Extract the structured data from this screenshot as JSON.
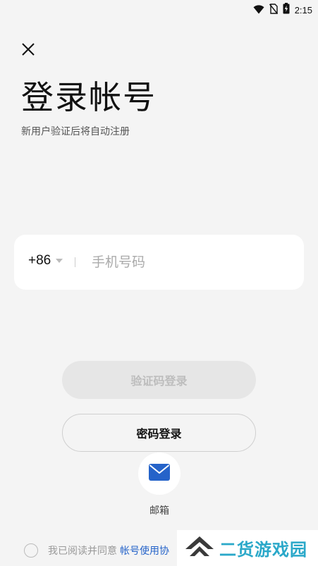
{
  "status_bar": {
    "time": "2:15",
    "icons": [
      "wifi-icon",
      "no-sim-icon",
      "battery-charging-icon"
    ]
  },
  "header": {
    "close_icon": "close-icon",
    "title": "登录帐号",
    "subtitle": "新用户验证后将自动注册"
  },
  "phone_form": {
    "country_code": "+86",
    "phone_placeholder": "手机号码",
    "phone_value": ""
  },
  "actions": {
    "sms_login_label": "验证码登录",
    "password_login_label": "密码登录",
    "email_label": "邮箱"
  },
  "agreement": {
    "text": "我已阅读并同意",
    "link": "帐号使用协"
  },
  "watermark": {
    "text": "二货游戏园"
  },
  "colors": {
    "background": "#f4f4f4",
    "accent_blue": "#2563c9",
    "watermark_teal": "#2aa8c9",
    "disabled_button": "#e6e6e6"
  }
}
